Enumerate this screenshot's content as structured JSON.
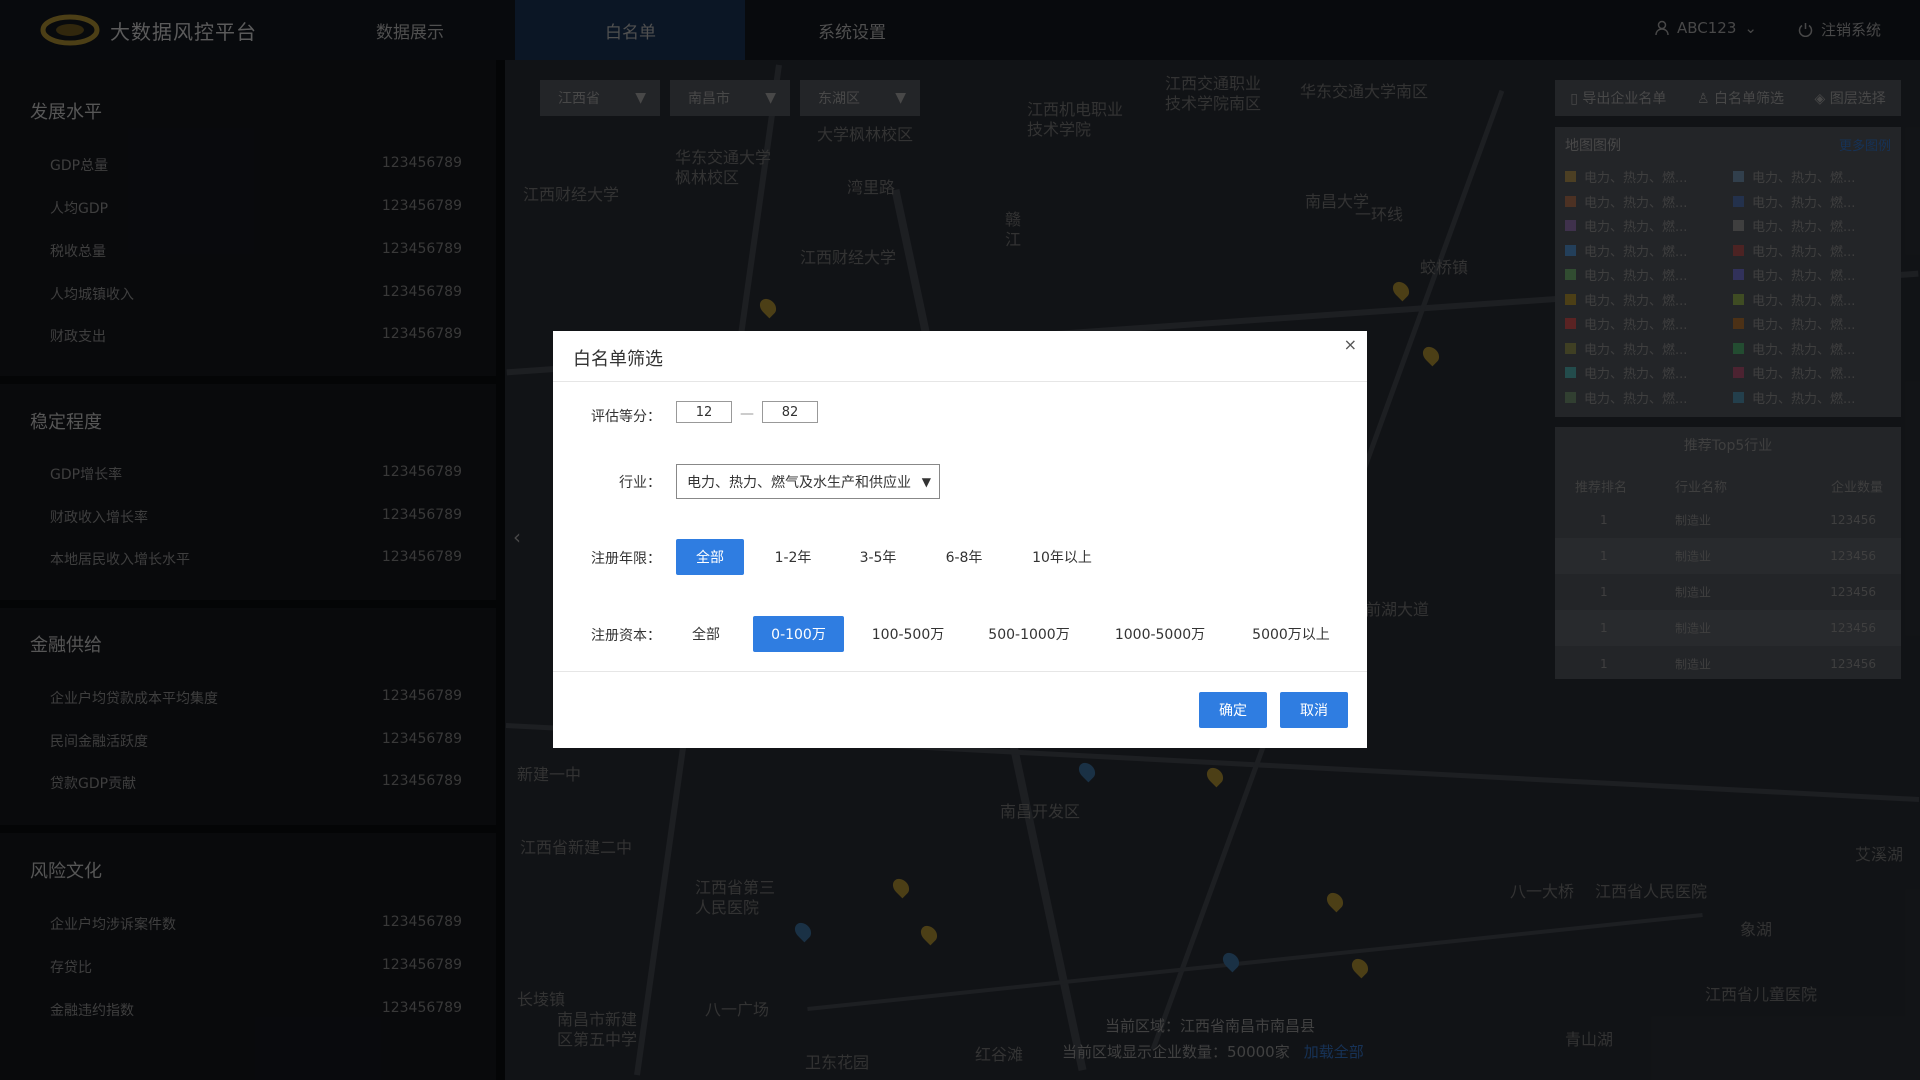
{
  "header": {
    "app_title": "大数据风控平台",
    "nav": [
      "数据展示",
      "白名单",
      "系统设置"
    ],
    "user": "ABC123",
    "logout": "注销系统"
  },
  "sidebar": {
    "sections": [
      {
        "title": "发展水平",
        "items": [
          {
            "label": "GDP总量",
            "value": "123456789"
          },
          {
            "label": "人均GDP",
            "value": "123456789"
          },
          {
            "label": "税收总量",
            "value": "123456789"
          },
          {
            "label": "人均城镇收入",
            "value": "123456789"
          },
          {
            "label": "财政支出",
            "value": "123456789"
          }
        ]
      },
      {
        "title": "稳定程度",
        "items": [
          {
            "label": "GDP增长率",
            "value": "123456789"
          },
          {
            "label": "财政收入增长率",
            "value": "123456789"
          },
          {
            "label": "本地居民收入增长水平",
            "value": "123456789"
          }
        ]
      },
      {
        "title": "金融供给",
        "items": [
          {
            "label": "企业户均贷款成本平均集度",
            "value": "123456789"
          },
          {
            "label": "民间金融活跃度",
            "value": "123456789"
          },
          {
            "label": "贷款GDP贡献",
            "value": "123456789"
          }
        ]
      },
      {
        "title": "风险文化",
        "items": [
          {
            "label": "企业户均涉诉案件数",
            "value": "123456789"
          },
          {
            "label": "存贷比",
            "value": "123456789"
          },
          {
            "label": "金融违约指数",
            "value": "123456789"
          }
        ]
      }
    ]
  },
  "map": {
    "selects": [
      "江西省",
      "南昌市",
      "东湖区"
    ],
    "labels": [
      "江西交通职业技术学院南区",
      "华东交通大学南区",
      "江西机电职业技术学院",
      "大学枫林校区",
      "华东交通大学枫林校区",
      "江西财经大学",
      "南昌大学",
      "湾里路",
      "江西财经大学",
      "一环线",
      "蛟桥镇",
      "江西省新建二中",
      "江西省第三人民医院",
      "八一大桥",
      "江西省人民医院",
      "南昌开发区",
      "新建一中",
      "江西省儿童医院",
      "南昌市新建区第五中学",
      "卫东花园",
      "红谷滩",
      "青山湖",
      "艾溪湖",
      "八一广场",
      "象湖",
      "长堎镇",
      "前湖大道",
      "赣江"
    ],
    "footer_region_label": "当前区域：江西省南昌市南昌县",
    "footer_count_label": "当前区域显示企业数量：50000家",
    "footer_link": "加载全部"
  },
  "right_panel": {
    "actions": [
      "导出企业名单",
      "白名单筛选",
      "图层选择"
    ],
    "legend_title": "地图图例",
    "legend_more": "更多图例",
    "legend_item_label": "电力、热力、燃...",
    "legend_colors": [
      "#5a4a2a",
      "#3a4a5a",
      "#5a3a2a",
      "#2a3a5a",
      "#4a3a5a",
      "#4a4a4a",
      "#2a4a6a",
      "#5a2a2a",
      "#3a5a3a",
      "#3a3a6a",
      "#5a4a1a",
      "#4a5a2a",
      "#6a2a2a",
      "#5a3a1a",
      "#4a4a2a",
      "#2a5a3a",
      "#2a5a5a",
      "#5a2a3a",
      "#3a4a3a",
      "#2a4a5a"
    ],
    "top5_title": "推荐Top5行业",
    "top5_headers": [
      "推荐排名",
      "行业名称",
      "企业数量"
    ],
    "top5_rows": [
      [
        "1",
        "制造业",
        "123456"
      ],
      [
        "1",
        "制造业",
        "123456"
      ],
      [
        "1",
        "制造业",
        "123456"
      ],
      [
        "1",
        "制造业",
        "123456"
      ],
      [
        "1",
        "制造业",
        "123456"
      ]
    ]
  },
  "modal": {
    "title": "白名单筛选",
    "score_label": "评估等分：",
    "score_min": "12",
    "score_max": "82",
    "industry_label": "行业：",
    "industry_value": "电力、热力、燃气及水生产和供应业",
    "years_label": "注册年限：",
    "years_options": [
      "全部",
      "1-2年",
      "3-5年",
      "6-8年",
      "10年以上"
    ],
    "years_selected": "全部",
    "capital_label": "注册资本：",
    "capital_options": [
      "全部",
      "0-100万",
      "100-500万",
      "500-1000万",
      "1000-5000万",
      "5000万以上"
    ],
    "capital_selected": "0-100万",
    "confirm": "确定",
    "cancel": "取消"
  }
}
